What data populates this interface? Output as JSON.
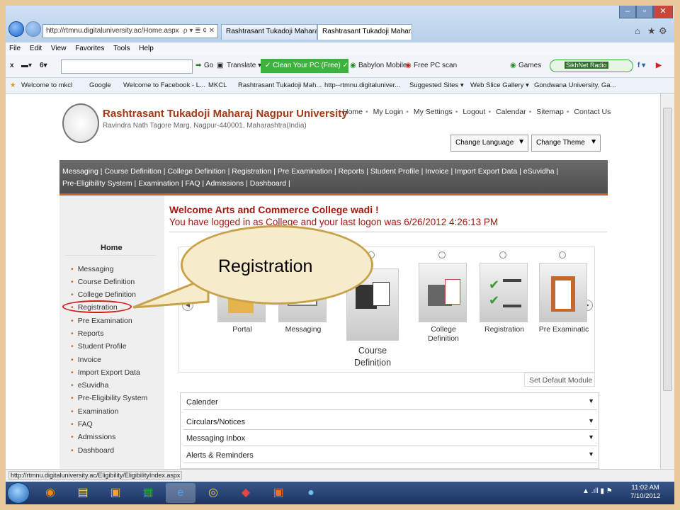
{
  "browser": {
    "address": "http://rtmnu.digitaluniversity.ac/Home.aspx",
    "address_controls": "ρ ▾ ≣ ¢ ✕",
    "tabs": [
      "Rashtrasant Tukadoji Maharaj ...",
      "Rashtrasant Tukadoji Mahar..."
    ],
    "tab_close": "×",
    "menu": [
      "File",
      "Edit",
      "View",
      "Favorites",
      "Tools",
      "Help"
    ],
    "toolbar": {
      "go": "Go",
      "translate": "Translate ▾",
      "clean": "✓ Clean Your PC (Free) ✓",
      "babylon": "Babylon Mobile",
      "freepc": "Free PC scan",
      "games": "Games",
      "radio": "SikhNet Radio"
    },
    "favorites": [
      "Welcome to mkcl",
      "Google",
      "Welcome to Facebook - L...",
      "MKCL",
      "Rashtrasant Tukadoji Mah...",
      "http--rtmnu.digitaluniver...",
      "Suggested Sites ▾",
      "Web Slice Gallery ▾",
      "Gondwana University, Ga..."
    ],
    "status_url": "http://rtmnu.digitaluniversity.ac/Eligibility/EligibilityIndex.aspx"
  },
  "university": {
    "name": "Rashtrasant Tukadoji Maharaj Nagpur University",
    "address": "Ravindra Nath Tagore Marg, Nagpur-440001, Maharashtra(India)"
  },
  "toplinks": [
    "Home",
    "My Login",
    "My Settings",
    "Logout",
    "Calendar",
    "Sitemap",
    "Contact Us"
  ],
  "selects": {
    "language": "Change Language",
    "theme": "Change Theme"
  },
  "mainmenu": {
    "line1": "Messaging | Course Definition | College Definition | Registration | Pre Examination | Reports | Student Profile | Invoice | Import Export Data | eSuvidha |",
    "line2": "Pre-Eligibility System | Examination | FAQ | Admissions | Dashboard |"
  },
  "sidebar": {
    "title": "Home",
    "items": [
      "Messaging",
      "Course Definition",
      "College Definition",
      "Registration",
      "Pre Examination",
      "Reports",
      "Student Profile",
      "Invoice",
      "Import Export Data",
      "eSuvidha",
      "Pre-Eligibility System",
      "Examination",
      "FAQ",
      "Admissions",
      "Dashboard"
    ]
  },
  "welcome": {
    "title": "Welcome Arts and Commerce College wadi !",
    "logged": "You have logged in as College and your last logon was 6/26/2012 4:26:13 PM"
  },
  "modules": [
    {
      "label": "Portal"
    },
    {
      "label": "Messaging"
    },
    {
      "label": "Course Definition"
    },
    {
      "label": "College Definition"
    },
    {
      "label": "Registration"
    },
    {
      "label": "Pre Examinatic"
    }
  ],
  "set_default": "Set Default Module",
  "accordion": [
    "Calender",
    "Circulars/Notices",
    "Messaging Inbox",
    "Alerts & Reminders"
  ],
  "callout": "Registration",
  "clock": {
    "time": "11:02 AM",
    "date": "7/10/2012"
  },
  "colors": {
    "accent": "#a3170f",
    "brand": "#a33a14",
    "menu": "#5a5a5a",
    "callout": "#f6ebcb"
  }
}
